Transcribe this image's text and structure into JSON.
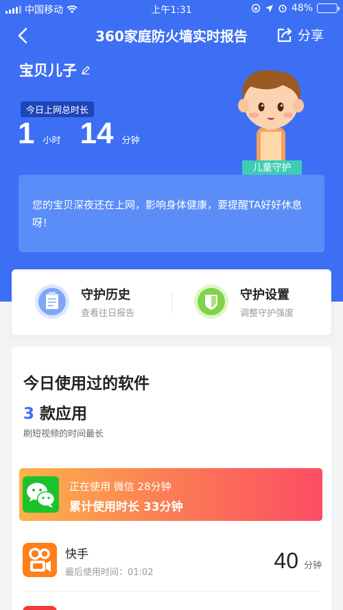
{
  "status_bar": {
    "carrier": "中国移动",
    "time": "上午1:31",
    "battery_pct": "48%",
    "battery_level": 0.48
  },
  "nav": {
    "title": "360家庭防火墙实时报告",
    "share_label": "分享"
  },
  "child": {
    "name": "宝贝儿子"
  },
  "usage": {
    "label": "今日上网总时长",
    "hours": "1",
    "hours_unit": "小时",
    "minutes": "14",
    "minutes_unit": "分钟"
  },
  "mascot_badge": "儿童守护",
  "alert_text": "您的宝贝深夜还在上网，影响身体健康，要提醒TA好好休息呀！",
  "guard": {
    "history_title": "守护历史",
    "history_sub": "查看往日报告",
    "settings_title": "守护设置",
    "settings_sub": "调整守护强度"
  },
  "apps": {
    "title": "今日使用过的软件",
    "count": "3",
    "count_suffix": "款应用",
    "subtitle": "刷短视频的时间最长",
    "current": {
      "line1": "正在使用  微信  28分钟",
      "line2": "累计使用时长  33分钟"
    },
    "list": [
      {
        "name": "快手",
        "last_used": "最后使用时间：01:02",
        "duration": "40",
        "unit": "分钟"
      }
    ]
  },
  "colors": {
    "brand_blue": "#3d6ff4",
    "wechat_green": "#1cc22c",
    "kuaishou_orange": "#ff7f1b"
  }
}
